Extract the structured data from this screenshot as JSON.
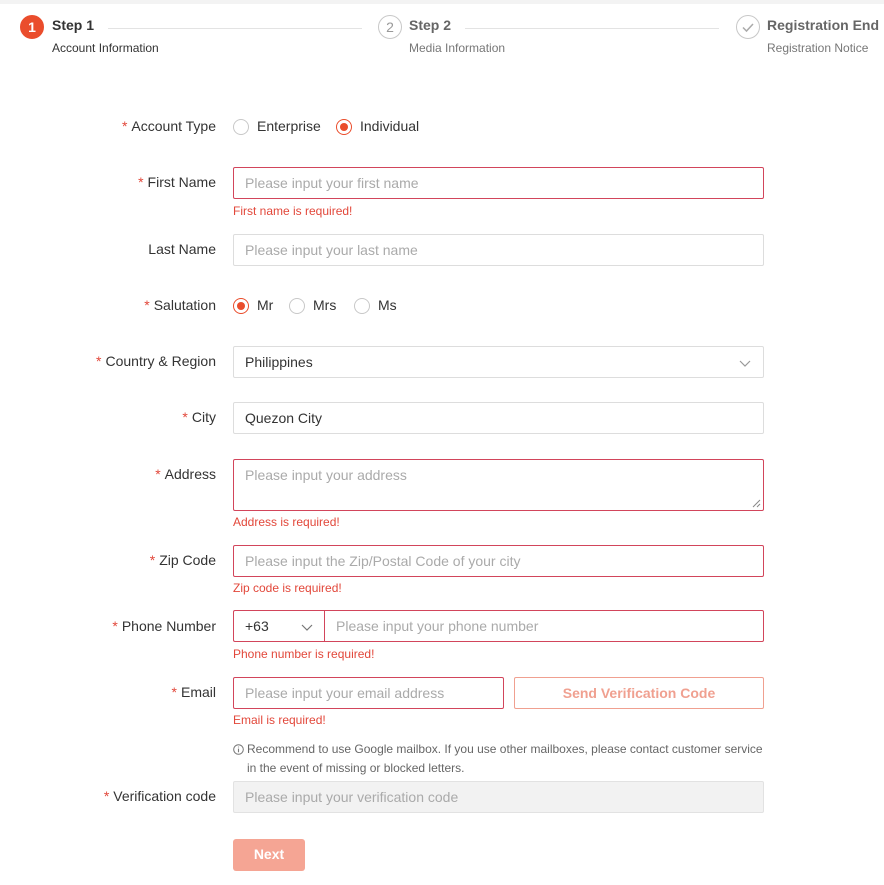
{
  "steps": [
    {
      "number": "1",
      "title": "Step 1",
      "desc": "Account Information"
    },
    {
      "number": "2",
      "title": "Step 2",
      "desc": "Media Information"
    },
    {
      "title": "Registration End",
      "desc": "Registration Notice"
    }
  ],
  "form": {
    "account_type": {
      "label": "Account Type",
      "options": [
        "Enterprise",
        "Individual"
      ],
      "selected": "Individual"
    },
    "first_name": {
      "label": "First Name",
      "placeholder": "Please input your first name",
      "error": "First name is required!"
    },
    "last_name": {
      "label": "Last Name",
      "placeholder": "Please input your last name"
    },
    "salutation": {
      "label": "Salutation",
      "options": [
        "Mr",
        "Mrs",
        "Ms"
      ],
      "selected": "Mr"
    },
    "country": {
      "label": "Country & Region",
      "value": "Philippines"
    },
    "city": {
      "label": "City",
      "value": "Quezon City"
    },
    "address": {
      "label": "Address",
      "placeholder": "Please input your address",
      "error": "Address is required!"
    },
    "zip": {
      "label": "Zip Code",
      "placeholder": "Please input the Zip/Postal Code of your city",
      "error": "Zip code is required!"
    },
    "phone": {
      "label": "Phone Number",
      "code": "+63",
      "placeholder": "Please input your phone number",
      "error": "Phone number is required!"
    },
    "email": {
      "label": "Email",
      "placeholder": "Please input your email address",
      "error": "Email is required!",
      "send_code": "Send Verification Code"
    },
    "hint": {
      "line1": "Recommend to use Google mailbox. If you use other mailboxes, please contact customer service",
      "line2": "in the event of missing or blocked letters."
    },
    "verification": {
      "label": "Verification code",
      "placeholder": "Please input your verification code"
    },
    "required_mark": "*",
    "next": "Next"
  },
  "colors": {
    "accent": "#ea4d2c",
    "error": "#e2473a",
    "error_border": "#d2455b"
  }
}
